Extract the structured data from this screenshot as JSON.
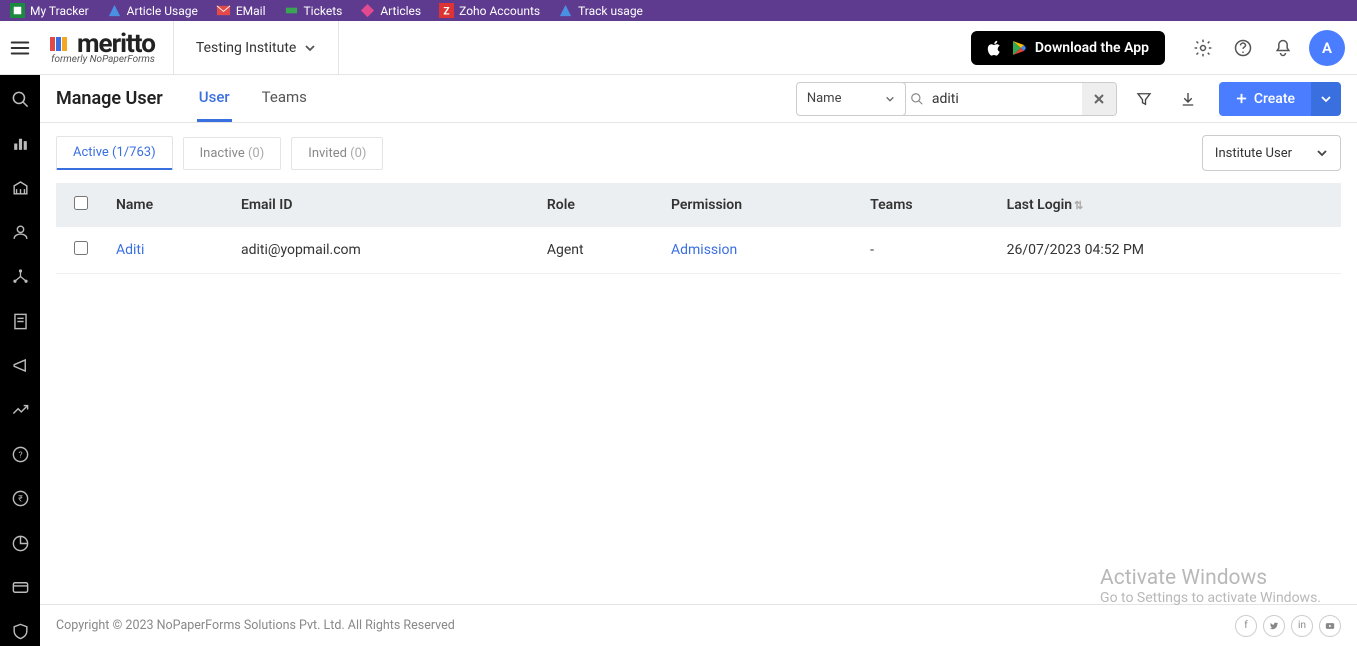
{
  "bookmarks": {
    "my_tracker": "My Tracker",
    "article_usage": "Article Usage",
    "email": "EMail",
    "tickets": "Tickets",
    "articles": "Articles",
    "zoho_accounts": "Zoho Accounts",
    "track_usage": "Track usage"
  },
  "header": {
    "brand": "meritto",
    "brand_sub": "formerly NoPaperForms",
    "institute": "Testing Institute",
    "download_label": "Download the App",
    "avatar_initial": "A"
  },
  "page": {
    "title": "Manage User",
    "tab_user": "User",
    "tab_teams": "Teams",
    "search_field": "Name",
    "search_value": "aditi",
    "create_label": "Create"
  },
  "filter_tabs": {
    "active_label": "Active",
    "active_count": "(1/763)",
    "inactive_label": "Inactive",
    "inactive_count": "(0)",
    "invited_label": "Invited",
    "invited_count": "(0)"
  },
  "user_type_select": "Institute User",
  "table": {
    "headers": {
      "name": "Name",
      "email": "Email ID",
      "role": "Role",
      "permission": "Permission",
      "teams": "Teams",
      "last_login": "Last Login"
    },
    "rows": [
      {
        "name": "Aditi",
        "email": "aditi@yopmail.com",
        "role": "Agent",
        "permission": "Admission",
        "teams": "-",
        "last_login": "26/07/2023 04:52 PM"
      }
    ]
  },
  "footer": {
    "copyright": "Copyright © 2023 NoPaperForms Solutions Pvt. Ltd. All Rights Reserved"
  },
  "watermark": {
    "heading": "Activate Windows",
    "sub": "Go to Settings to activate Windows."
  }
}
